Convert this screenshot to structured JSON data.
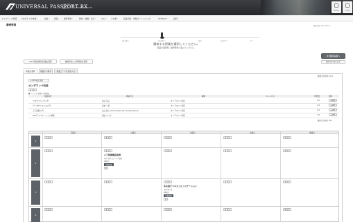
{
  "header": {
    "logo_text": "UNIVERSAL PASSPORT RX",
    "user_line1": "山田 花子さん",
    "user_line2": "最終ログイン：2022/04/22 17:30",
    "right_buttons": [
      "Setting",
      "Logout"
    ]
  },
  "nav": {
    "items": [
      "マイステップ情報",
      "プロダクトの支援・",
      "出席・",
      "授業・",
      "履修登録・",
      "教材・成績・点の・",
      "Q&A・",
      "その他・",
      "就業手帳・学籍ボートフォリオ",
      "RESERVE・",
      "設問・"
    ]
  },
  "page": {
    "title": "履修登録",
    "page_id": "履修登録 (Emr0053)"
  },
  "progress": {
    "steps": [
      "曜日選択",
      "科目選択",
      "確認",
      "申請完了",
      "完了"
    ],
    "instruction1": "履修する授業を選択してください。",
    "instruction2": "授業を選択後、履修登録へ進んでください。"
  },
  "actions": {
    "copy_prev": "2022年度前期の授業を選択",
    "apply_other": "履修申請した時間割を選択",
    "next_button": "次 確認画面へ",
    "check_button": "履修内容を見て戻す"
  },
  "tabs": [
    "授業を選択",
    "授業から探す",
    "授業コードを直接入力"
  ],
  "panel": {
    "units_total": "履修合計単位 10.0",
    "semester_select": "＜2022年度 前期",
    "section_title": "オンデマンド科目",
    "add_label": "▼ 追加",
    "filter_label": "■ ドラッグ 並替可 (授業毎)"
  },
  "course_table": {
    "headers": [
      "授業科目",
      "教員氏名",
      "曜限",
      "キャンパス",
      "単位数",
      "削除"
    ],
    "rows": [
      [
        "プログラミング入門",
        "青山 花子",
        "オンデマンド科目",
        "",
        "2.0",
        "▲ 削除"
      ],
      [
        "データサイエンス入門",
        "赤松 一郎",
        "オンデマンド科目",
        "",
        "2.0",
        "▲ 削除"
      ],
      [
        "人工知能入門",
        "山口 健二 (Humanities Nor Studies Room)",
        "オンデマンド科目",
        "",
        "2.0",
        "▲ 削除"
      ],
      [
        "Webアプリケーション開発",
        "浦田 マリ子",
        "オンデマンド科目",
        "",
        "2.0",
        "▲ 削除"
      ]
    ],
    "footnote": "履修合計単位 10.0"
  },
  "timetable": {
    "days": [
      "月曜日",
      "火曜日",
      "水曜日",
      "木曜日",
      "金曜日"
    ],
    "periods": [
      "1",
      "2",
      "3",
      "4"
    ],
    "add_label": "▼ 追加",
    "entries": [
      {
        "title": "人工知能概説実践",
        "detail1": "南下 布美 (ユーザー情報)",
        "detail2": "AB科目",
        "badge": "授業詳細",
        "remove": "▼"
      },
      {
        "title": "多言語ビジネスコミュニケーション",
        "detail1": "中村 健一郎",
        "detail2": "AB科目",
        "badge": "授業詳細",
        "remove": "▼"
      }
    ]
  }
}
